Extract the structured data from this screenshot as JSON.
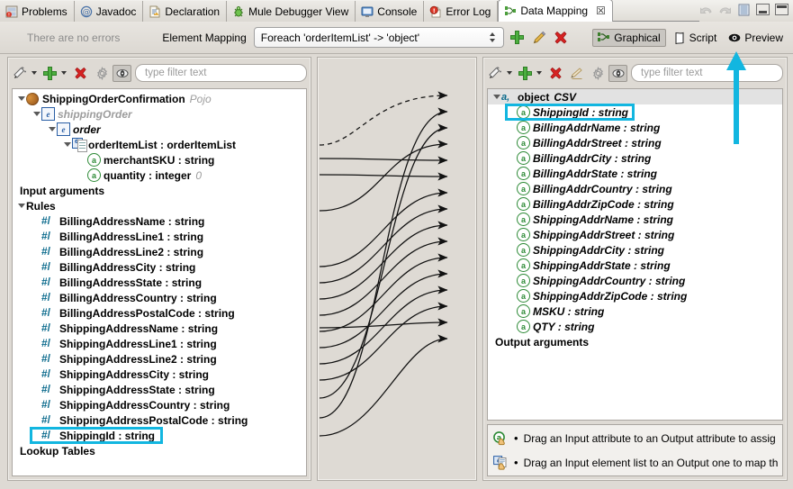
{
  "window": {
    "tabs": [
      {
        "label": "Problems",
        "icon": "problems-icon",
        "active": false
      },
      {
        "label": "Javadoc",
        "icon": "javadoc-at-icon",
        "active": false
      },
      {
        "label": "Declaration",
        "icon": "declaration-icon",
        "active": false
      },
      {
        "label": "Mule Debugger View",
        "icon": "mule-bug-icon",
        "active": false
      },
      {
        "label": "Console",
        "icon": "console-icon",
        "active": false
      },
      {
        "label": "Error Log",
        "icon": "error-log-icon",
        "active": false
      },
      {
        "label": "Data Mapping",
        "icon": "data-mapping-icon",
        "active": true,
        "close": "☒"
      }
    ],
    "tab_tools": [
      "back-arrow-icon",
      "forward-arrow-icon",
      "view-menu-icon"
    ],
    "minimize_label": "minimize",
    "maximize_label": "maximize"
  },
  "toolbar": {
    "status_text": "There are no errors",
    "element_mapping_label": "Element Mapping",
    "element_mapping_value": "Foreach 'orderItemList' -> 'object'",
    "add_label": "add-mapping",
    "edit_label": "edit-mapping",
    "delete_label": "delete-mapping",
    "views": [
      {
        "label": "Graphical",
        "icon": "graphical-icon",
        "selected": true
      },
      {
        "label": "Script",
        "icon": "script-icon",
        "selected": false
      },
      {
        "label": "Preview",
        "icon": "preview-eye-icon",
        "selected": false
      }
    ]
  },
  "left_panel": {
    "toolbar": {
      "wand": "magic-wand-icon",
      "add": "add-icon",
      "delete": "delete-icon",
      "settings": "gear-icon",
      "show": "eye-icon",
      "filter_placeholder": "type filter text"
    },
    "tree": [
      {
        "label": "ShippingOrderConfirmation",
        "suffix": "Pojo",
        "indent": 0,
        "twisty": true,
        "icon": "pojo-bean-icon",
        "style": "bold"
      },
      {
        "label": "shippingOrder",
        "indent": 1,
        "twisty": true,
        "icon": "element-e-icon",
        "style": "gray-italic"
      },
      {
        "label": "order",
        "indent": 2,
        "twisty": true,
        "icon": "element-e-icon",
        "style": "italic-bold"
      },
      {
        "label": "orderItemList : orderItemList",
        "indent": 3,
        "twisty": true,
        "icon": "element-list-icon",
        "style": "bold"
      },
      {
        "label": "merchantSKU : string",
        "indent": 4,
        "twisty": false,
        "icon": "attribute-a-icon",
        "style": "bold"
      },
      {
        "label": "quantity : integer",
        "suffix": "0",
        "indent": 4,
        "twisty": false,
        "icon": "attribute-a-icon",
        "style": "bold"
      },
      {
        "label": "Input arguments",
        "indent": 0,
        "twisty": false,
        "icon": "none",
        "style": "bold",
        "pad": 1
      },
      {
        "label": "Rules",
        "indent": 0,
        "twisty": true,
        "icon": "none",
        "style": "bold"
      },
      {
        "label": "BillingAddressName : string",
        "indent": 1,
        "twisty": false,
        "icon": "hash-icon",
        "style": "bold"
      },
      {
        "label": "BillingAddressLine1 : string",
        "indent": 1,
        "twisty": false,
        "icon": "hash-icon",
        "style": "bold"
      },
      {
        "label": "BillingAddressLine2 : string",
        "indent": 1,
        "twisty": false,
        "icon": "hash-icon",
        "style": "bold"
      },
      {
        "label": "BillingAddressCity : string",
        "indent": 1,
        "twisty": false,
        "icon": "hash-icon",
        "style": "bold"
      },
      {
        "label": "BillingAddressState : string",
        "indent": 1,
        "twisty": false,
        "icon": "hash-icon",
        "style": "bold"
      },
      {
        "label": "BillingAddressCountry : string",
        "indent": 1,
        "twisty": false,
        "icon": "hash-icon",
        "style": "bold"
      },
      {
        "label": "BillingAddressPostalCode : string",
        "indent": 1,
        "twisty": false,
        "icon": "hash-icon",
        "style": "bold"
      },
      {
        "label": "ShippingAddressName : string",
        "indent": 1,
        "twisty": false,
        "icon": "hash-icon",
        "style": "bold"
      },
      {
        "label": "ShippingAddressLine1 : string",
        "indent": 1,
        "twisty": false,
        "icon": "hash-icon",
        "style": "bold"
      },
      {
        "label": "ShippingAddressLine2 : string",
        "indent": 1,
        "twisty": false,
        "icon": "hash-icon",
        "style": "bold"
      },
      {
        "label": "ShippingAddressCity : string",
        "indent": 1,
        "twisty": false,
        "icon": "hash-icon",
        "style": "bold"
      },
      {
        "label": "ShippingAddressState : string",
        "indent": 1,
        "twisty": false,
        "icon": "hash-icon",
        "style": "bold"
      },
      {
        "label": "ShippingAddressCountry : string",
        "indent": 1,
        "twisty": false,
        "icon": "hash-icon",
        "style": "bold"
      },
      {
        "label": "ShippingAddressPostalCode : string",
        "indent": 1,
        "twisty": false,
        "icon": "hash-icon",
        "style": "bold"
      },
      {
        "label": "ShippingId : string",
        "indent": 1,
        "twisty": false,
        "icon": "hash-icon",
        "style": "bold",
        "highlight": true
      },
      {
        "label": "Lookup Tables",
        "indent": 0,
        "twisty": false,
        "icon": "none",
        "style": "bold",
        "pad": 1
      }
    ]
  },
  "right_panel": {
    "toolbar": {
      "wand": "magic-wand-icon",
      "add": "add-icon",
      "delete": "delete-icon",
      "rename": "rename-pencil-icon",
      "settings": "gear-icon",
      "show": "eye-icon",
      "filter_placeholder": "type filter text"
    },
    "tree": [
      {
        "label": "object",
        "suffix": "CSV",
        "indent": 0,
        "twisty": true,
        "icon": "csv-a-icon",
        "style": "bold",
        "header": true
      },
      {
        "label": "ShippingId : string",
        "indent": 1,
        "twisty": false,
        "icon": "attribute-a-icon",
        "style": "italic-bold",
        "highlight": true
      },
      {
        "label": "BillingAddrName : string",
        "indent": 1,
        "twisty": false,
        "icon": "attribute-a-icon",
        "style": "italic-bold"
      },
      {
        "label": "BillingAddrStreet : string",
        "indent": 1,
        "twisty": false,
        "icon": "attribute-a-icon",
        "style": "italic-bold"
      },
      {
        "label": "BillingAddrCity : string",
        "indent": 1,
        "twisty": false,
        "icon": "attribute-a-icon",
        "style": "italic-bold"
      },
      {
        "label": "BillingAddrState : string",
        "indent": 1,
        "twisty": false,
        "icon": "attribute-a-icon",
        "style": "italic-bold"
      },
      {
        "label": "BillingAddrCountry : string",
        "indent": 1,
        "twisty": false,
        "icon": "attribute-a-icon",
        "style": "italic-bold"
      },
      {
        "label": "BillingAddrZipCode : string",
        "indent": 1,
        "twisty": false,
        "icon": "attribute-a-icon",
        "style": "italic-bold"
      },
      {
        "label": "ShippingAddrName : string",
        "indent": 1,
        "twisty": false,
        "icon": "attribute-a-icon",
        "style": "italic-bold"
      },
      {
        "label": "ShippingAddrStreet : string",
        "indent": 1,
        "twisty": false,
        "icon": "attribute-a-icon",
        "style": "italic-bold"
      },
      {
        "label": "ShippingAddrCity : string",
        "indent": 1,
        "twisty": false,
        "icon": "attribute-a-icon",
        "style": "italic-bold"
      },
      {
        "label": "ShippingAddrState : string",
        "indent": 1,
        "twisty": false,
        "icon": "attribute-a-icon",
        "style": "italic-bold"
      },
      {
        "label": "ShippingAddrCountry : string",
        "indent": 1,
        "twisty": false,
        "icon": "attribute-a-icon",
        "style": "italic-bold"
      },
      {
        "label": "ShippingAddrZipCode : string",
        "indent": 1,
        "twisty": false,
        "icon": "attribute-a-icon",
        "style": "italic-bold"
      },
      {
        "label": "MSKU : string",
        "indent": 1,
        "twisty": false,
        "icon": "attribute-a-icon",
        "style": "italic-bold"
      },
      {
        "label": "QTY : string",
        "indent": 1,
        "twisty": false,
        "icon": "attribute-a-icon",
        "style": "italic-bold"
      },
      {
        "label": "Output arguments",
        "indent": 0,
        "twisty": false,
        "icon": "none",
        "style": "bold",
        "pad": 1
      }
    ],
    "hints": [
      {
        "icon": "drag-attribute-icon",
        "text": "Drag an Input attribute to an Output attribute to assig"
      },
      {
        "icon": "drag-element-list-icon",
        "text": "Drag an Input element list to an Output one to map th"
      }
    ]
  },
  "annotations": {
    "highlight_color": "#12b6e0",
    "arrow_color": "#12b6e0",
    "arrow_name": "preview-pointer-arrow"
  }
}
